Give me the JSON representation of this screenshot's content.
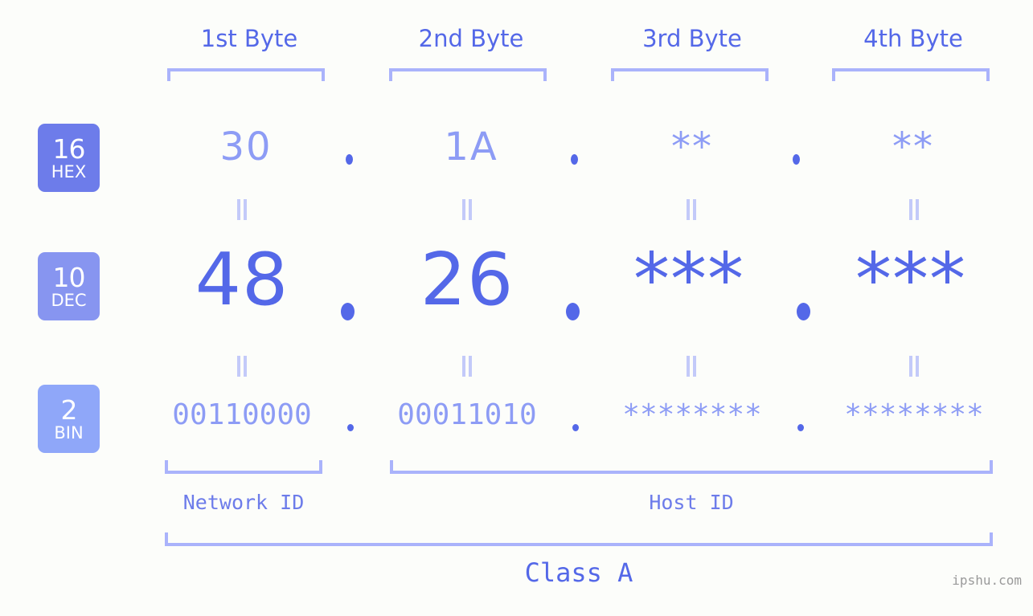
{
  "page": {
    "background_color": "#fcfdfa",
    "accent_color": "#5468e8",
    "accent_light_color": "#8d9cf5",
    "bracket_color": "#aab3fb"
  },
  "headers": [
    {
      "label": "1st Byte"
    },
    {
      "label": "2nd Byte"
    },
    {
      "label": "3rd Byte"
    },
    {
      "label": "4th Byte"
    }
  ],
  "rows": [
    {
      "badge_number": "16",
      "badge_system": "HEX",
      "badge_color": "#6d7cea",
      "values": [
        "30",
        "1A",
        "**",
        "**"
      ],
      "separator": "."
    },
    {
      "badge_number": "10",
      "badge_system": "DEC",
      "badge_color": "#8795f0",
      "values": [
        "48",
        "26",
        "***",
        "***"
      ],
      "separator": "."
    },
    {
      "badge_number": "2",
      "badge_system": "BIN",
      "badge_color": "#8fa7f9",
      "values": [
        "00110000",
        "00011010",
        "********",
        "********"
      ],
      "separator": "."
    }
  ],
  "equivalence_symbol": "=",
  "segments": {
    "network_id_label": "Network ID",
    "host_id_label": "Host ID"
  },
  "class_label": "Class A",
  "watermark": "ipshu.com"
}
